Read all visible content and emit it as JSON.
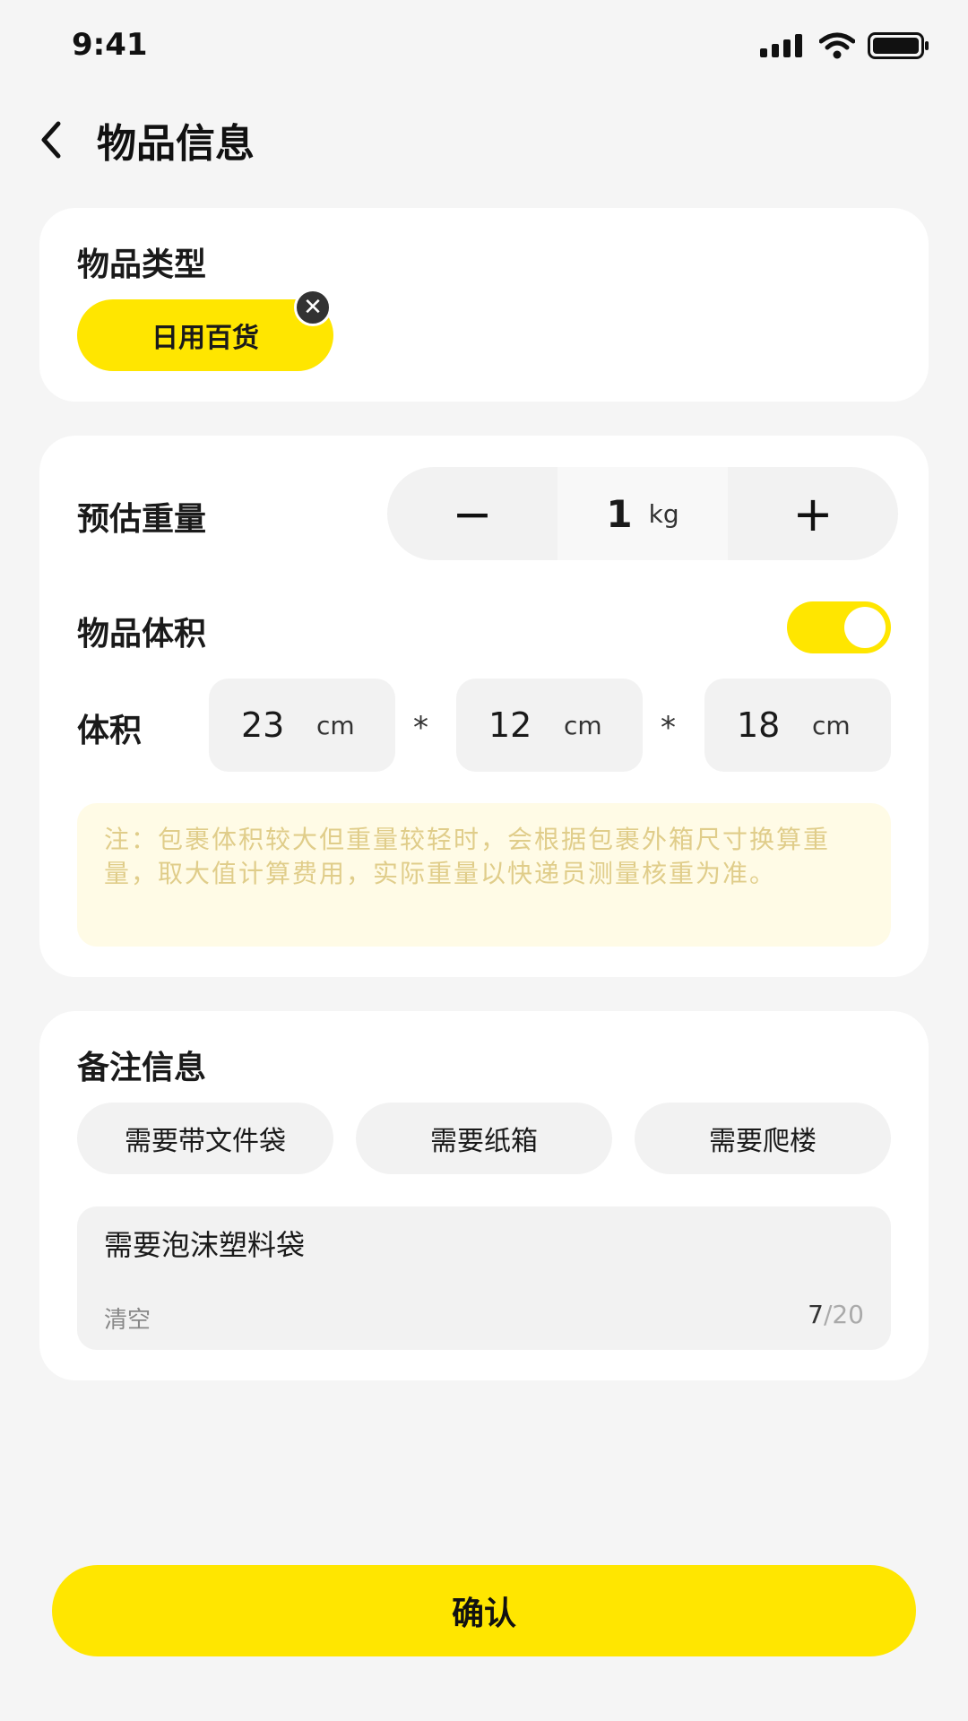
{
  "status_bar": {
    "time": "9:41"
  },
  "header": {
    "title": "物品信息"
  },
  "category": {
    "label": "物品类型",
    "selected": "日用百货",
    "remove_glyph": "✕"
  },
  "weight": {
    "label": "预估重量",
    "minus": "−",
    "plus": "+",
    "value": "1",
    "unit": "kg"
  },
  "volume_toggle": {
    "label": "物品体积",
    "on": true
  },
  "volume": {
    "label": "体积",
    "separator": "*",
    "unit": "cm",
    "length": "23",
    "width": "12",
    "height": "18"
  },
  "note": "注：包裹体积较大但重量较轻时，会根据包裹外箱尺寸换算重量，取大值计算费用，实际重量以快递员测量核重为准。",
  "remarks": {
    "label": "备注信息",
    "tags": [
      "需要带文件袋",
      "需要纸箱",
      "需要爬楼"
    ],
    "text": "需要泡沫塑料袋",
    "clear": "清空",
    "count": "7",
    "max": "/20"
  },
  "confirm": "确认",
  "colors": {
    "accent": "#ffe600",
    "background": "#f5f5f5",
    "note_text": "#e0cd8a"
  }
}
